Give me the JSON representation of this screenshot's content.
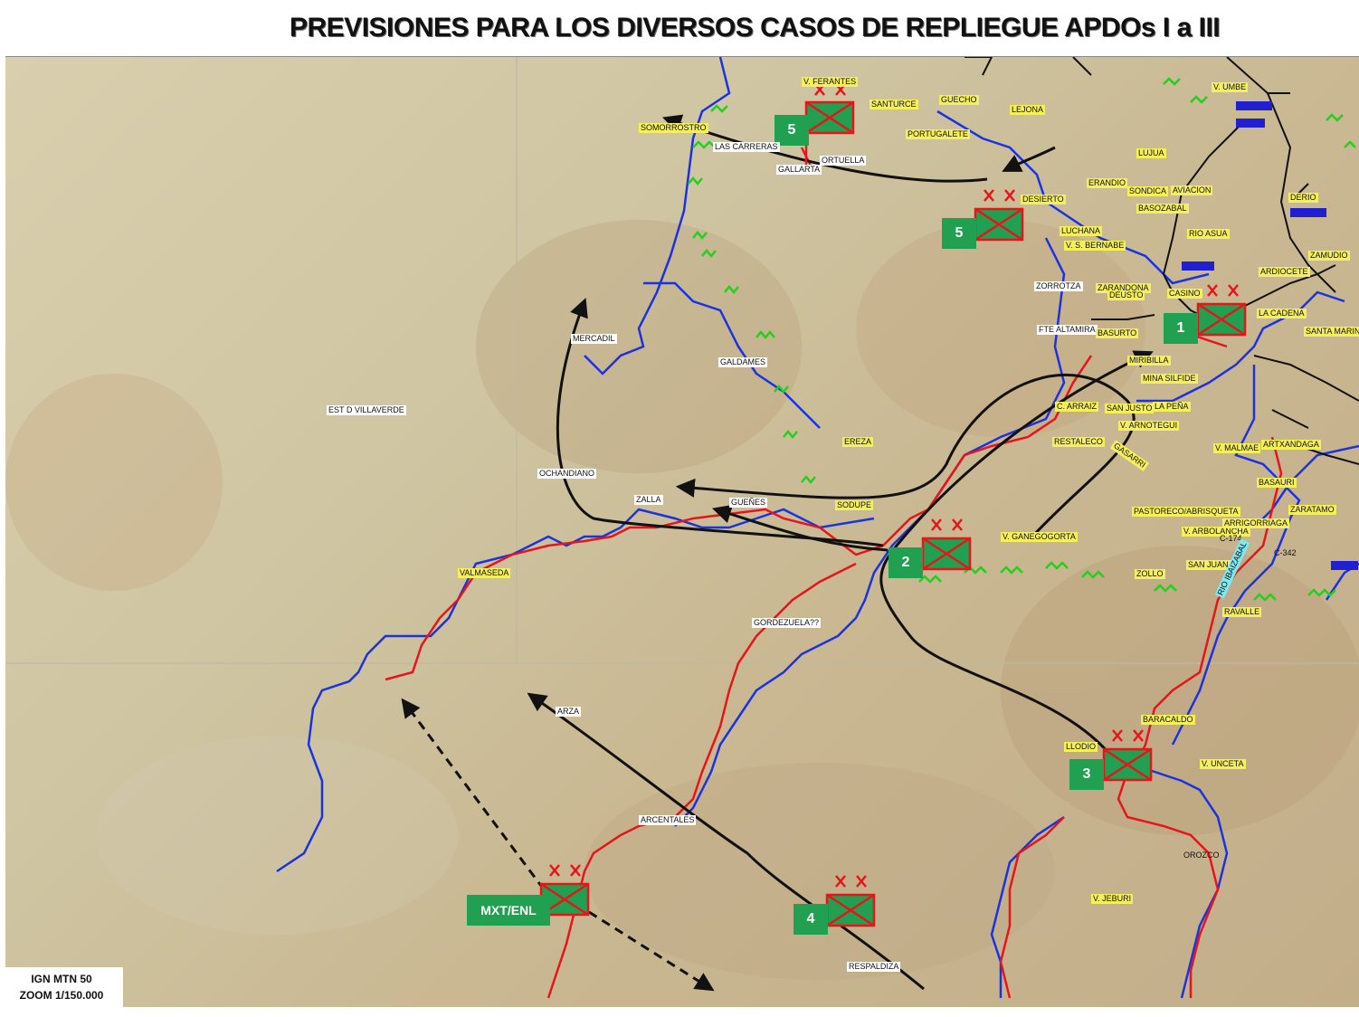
{
  "title": "PREVISIONES PARA LOS DIVERSOS CASOS DE REPLIEGUE APDOs I a III",
  "scale_note": {
    "line1": "IGN MTN 50",
    "line2": "ZOOM 1/150.000"
  },
  "units": {
    "u1": "1",
    "u2": "2",
    "u3": "3",
    "u4": "4",
    "u5a": "5",
    "u5b": "5",
    "mxt": "MXT/ENL"
  },
  "places": {
    "v_ferantes": "V. FERANTES",
    "santurce": "SANTURCE",
    "guecho": "GUECHO",
    "lejona": "LEJONA",
    "portugalete": "PORTUGALETE",
    "somorrostro": "SOMORROSTRO",
    "las_carreras": "LAS CARRERAS",
    "gallarta": "GALLARTA",
    "ortuella": "ORTUELLA",
    "desierto": "DESIERTO",
    "luchana": "LUCHANA",
    "erandio": "ERANDIO",
    "sondica": "SONDICA",
    "aviacion": "AVIACION",
    "basozabal": "BASOZABAL",
    "rio_asua": "RIO ASUA",
    "v_bernabe": "V. S. BERNABE",
    "deusto": "DEUSTO",
    "zorrotza": "ZORROTZA",
    "fte_altamira": "FTE ALTAMIRA",
    "basurto": "BASURTO",
    "mercadil": "MERCADIL",
    "galdames": "GALDAMES",
    "villaverde": "EST D VILLAVERDE",
    "ereza": "EREZA",
    "ochandiano": "OCHANDIANO",
    "zalla": "ZALLA",
    "guenes": "GUEÑES",
    "sodupe": "SODUPE",
    "valmaseda": "VALMASEDA",
    "gordezuela": "GORDEZUELA??",
    "arza": "ARZA",
    "arcentales": "ARCENTALES",
    "respaldiza": "RESPALDIZA",
    "v_ganegogorta": "V. GANEGOGORTA",
    "c_arraiz": "C. ARRAIZ",
    "san_justo": "SAN JUSTO",
    "la_pena": "LA PEÑA",
    "restaleco": "RESTALECO",
    "pastoreco": "PASTORECO/ABRISQUETA",
    "basauri": "BASAURI",
    "zaratamo": "ZARATAMO",
    "zollo": "ZOLLO",
    "san_juan": "SAN JUAN",
    "ravalle": "RAVALLE",
    "baracaldo": "BARACALDO",
    "llodio": "LLODIO",
    "v_uncueta": "V. UNCETA",
    "orozco": "OROZCO",
    "v_jeburi": "V. JEBURI",
    "v_umbe": "V. UMBE",
    "lujua": "LUJUA",
    "derio": "DERIO",
    "zamudio": "ZAMUDIO",
    "ardiochena": "ARDIOCETE",
    "la_cadena": "LA CADENA",
    "santa_marina": "SANTA MARINA",
    "arrigorriaga": "ARRIGORRIAGA",
    "arbolancha": "V. ARBOLANCHA",
    "v_maliade": "V. MALMAE",
    "v_arnotegui": "V. ARNOTEGUI",
    "artecalle": "ARTXANDAGA",
    "casino": "CASINO",
    "zarandona": "ZARANDONA",
    "mina_silfide": "MINA SILFIDE",
    "ribilla": "MIRIBILLA",
    "c174": "C-174",
    "c342": "C-342",
    "gasarri": "GASARRI",
    "rio_ibaizabal": "RIO IBAIZABAL"
  }
}
